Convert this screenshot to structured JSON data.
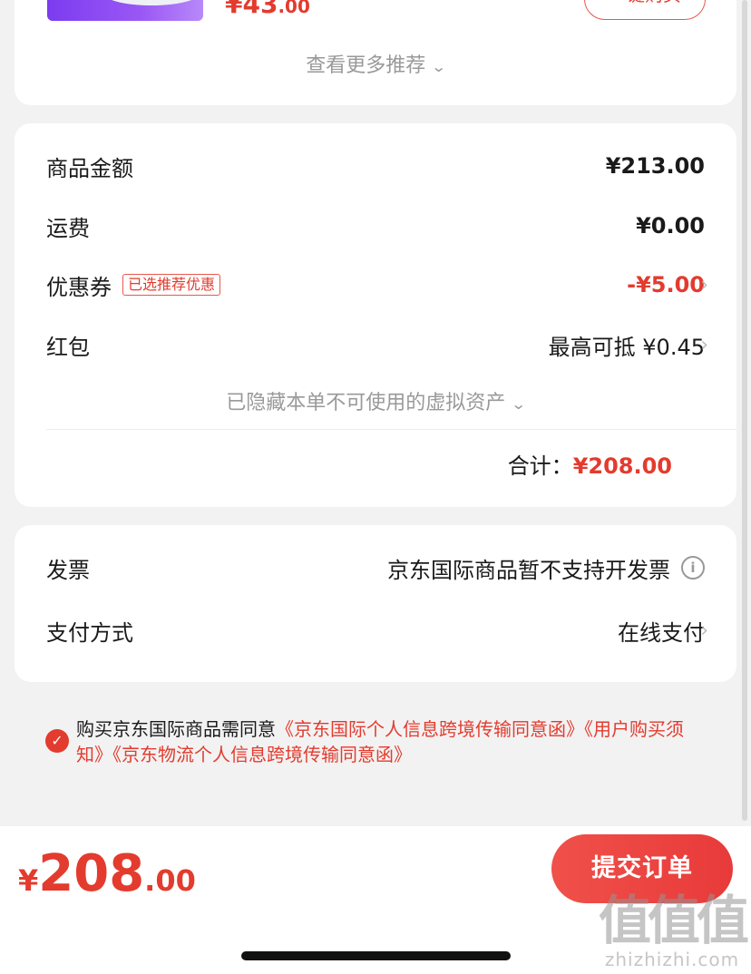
{
  "top_card": {
    "price_int": "¥43",
    "price_dec": ".00",
    "buy_button": "一键购买",
    "more_recommend": "查看更多推荐"
  },
  "summary": {
    "goods_amount": {
      "label": "商品金额",
      "value": "¥213.00"
    },
    "shipping": {
      "label": "运费",
      "value": "¥0.00"
    },
    "coupon": {
      "label": "优惠券",
      "tag": "已选推荐优惠",
      "value": "-¥5.00"
    },
    "red_packet": {
      "label": "红包",
      "value": "最高可抵 ¥0.45"
    },
    "hidden_assets": "已隐藏本单不可使用的虚拟资产",
    "total_label": "合计：",
    "total_value": "¥208.00"
  },
  "payment": {
    "invoice": {
      "label": "发票",
      "value": "京东国际商品暂不支持开发票"
    },
    "method": {
      "label": "支付方式",
      "value": "在线支付"
    }
  },
  "agreement": {
    "prefix": "购买京东国际商品需同意",
    "link1": "《京东国际个人信息跨境传输同意函》",
    "link2": "《用户购买须知》",
    "link3": "《京东物流个人信息跨境传输同意函》"
  },
  "bottom": {
    "yen": "¥",
    "price_int": "208",
    "price_dec": ".00",
    "submit": "提交订单"
  },
  "watermark": {
    "big": "值值值",
    "small": "zhizhizhi.com"
  },
  "colors": {
    "accent": "#e33b2e",
    "background": "#f2f2f2"
  }
}
